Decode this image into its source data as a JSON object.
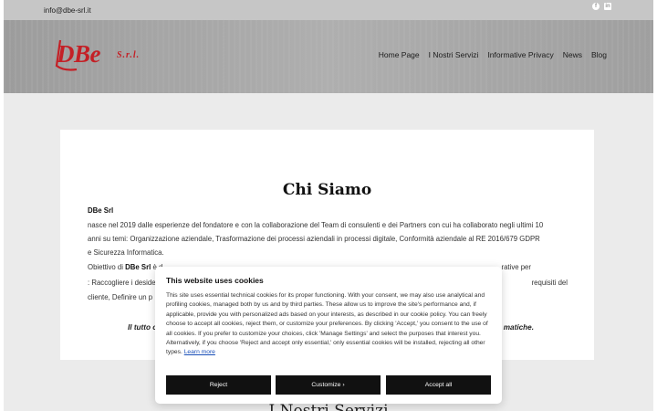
{
  "topbar": {
    "email": "info@dbe-srl.it",
    "social_icons": [
      "facebook-icon",
      "linkedin-icon"
    ]
  },
  "brand": {
    "name": "DBe",
    "suffix": "S.r.l.",
    "color": "#c42026"
  },
  "nav": {
    "items": [
      "Home Page",
      "I Nostri Servizi",
      "Informative Privacy",
      "News",
      "Blog"
    ]
  },
  "main": {
    "title": "Chi Siamo",
    "company": "DBe Srl",
    "line1": "nasce nel 2019 dalle esperienze del fondatore e con la collaborazione del Team di consulenti e dei Partners con cui ha collaborato negli ultimi 10",
    "line2": "anni su temi: Organizzazione aziendale, Trasformazione dei processi aziendali in processi digitale, Conformità aziendale al RE 2016/679 GDPR",
    "line3": "e Sicurezza Informatica.",
    "line4_prefix": "Obiettivo di ",
    "line4_bold": "DBe Srl",
    "line4_rest": " è d",
    "line4_tail": "rative per",
    "line5_prefix": ": Raccogliere i deside",
    "line5_tail": "requisiti del",
    "line6_prefix": "cliente, Definire un p",
    "italic_prefix": "Il tutto c",
    "italic_tail": "matiche."
  },
  "services": {
    "title": "I Nostri Servizi"
  },
  "cookie": {
    "title": "This website uses cookies",
    "text": "This site uses essential technical cookies for its proper functioning. With your consent, we may also use analytical and profiling cookies, managed both by us and by third parties. These allow us to improve the site's performance and, if applicable, provide you with personalized ads based on your interests, as described in our cookie policy. You can freely choose to accept all cookies, reject them, or customize your preferences. By clicking 'Accept,' you consent to the use of all cookies. If you prefer to customize your choices, click 'Manage Settings' and select the purposes that interest you. Alternatively, if you choose 'Reject and accept only essential,' only essential cookies will be installed, rejecting all other types.",
    "link": "Learn more",
    "reject": "Reject",
    "customize": "Customize ›",
    "accept": "Accept all"
  }
}
